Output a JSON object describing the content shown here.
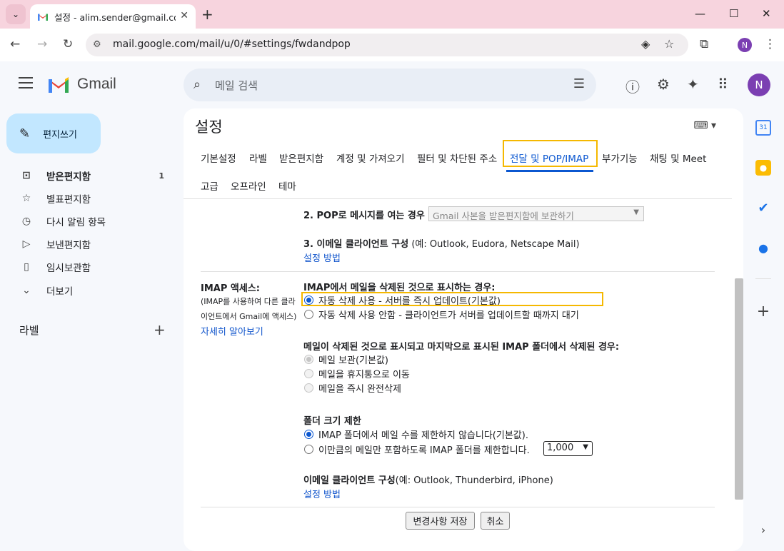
{
  "browser": {
    "tab_title": "설정 - alim.sender@gmail.com",
    "url": "mail.google.com/mail/u/0/#settings/fwdandpop",
    "profile_initial": "N"
  },
  "gmail": {
    "logo_text": "Gmail",
    "search_placeholder": "메일 검색",
    "avatar_initial": "N",
    "compose_label": "편지쓰기",
    "nav": [
      {
        "label": "받은편지함",
        "count": "1",
        "icon": "inbox-icon"
      },
      {
        "label": "별표편지함",
        "count": "",
        "icon": "star-icon"
      },
      {
        "label": "다시 알림 항목",
        "count": "",
        "icon": "clock-icon"
      },
      {
        "label": "보낸편지함",
        "count": "",
        "icon": "send-icon"
      },
      {
        "label": "임시보관함",
        "count": "",
        "icon": "draft-icon"
      },
      {
        "label": "더보기",
        "count": "",
        "icon": "chevron-down-icon"
      }
    ],
    "labels_header": "라벨"
  },
  "settings": {
    "title": "설정",
    "tabs_row1": [
      "기본설정",
      "라벨",
      "받은편지함",
      "계정 및 가져오기",
      "필터 및 차단된 주소",
      "전달 및 POP/IMAP",
      "부가기능",
      "채팅 및 Meet"
    ],
    "tabs_row2": [
      "고급",
      "오프라인",
      "테마"
    ],
    "pop": {
      "item2_label": "2. POP로 메시지를 여는 경우",
      "item2_select": "Gmail 사본을 받은편지함에 보관하기",
      "item3_label": "3. 이메일 클라이언트 구성",
      "item3_example": "(예: Outlook, Eudora, Netscape Mail)",
      "item3_link": "설정 방법"
    },
    "imap": {
      "side_title": "IMAP 액세스:",
      "side_desc1": "(IMAP를 사용하여 다른 클라",
      "side_desc2": "이언트에서 Gmail에 액세스)",
      "side_link": "자세히 알아보기",
      "delete_title": "IMAP에서 메일을 삭제된 것으로 표시하는 경우:",
      "delete_opt1": "자동 삭제 사용 - 서버를 즉시 업데이트(기본값)",
      "delete_opt2": "자동 삭제 사용 안함 - 클라이언트가 서버를 업데이트할 때까지 대기",
      "expunge_title": "메일이 삭제된 것으로 표시되고 마지막으로 표시된 IMAP 폴더에서 삭제된 경우:",
      "expunge_opt1": "메일 보관(기본값)",
      "expunge_opt2": "메일을 휴지통으로 이동",
      "expunge_opt3": "메일을 즉시 완전삭제",
      "folder_title": "폴더 크기 제한",
      "folder_opt1": "IMAP 폴더에서 메일 수를 제한하지 않습니다(기본값).",
      "folder_opt2": "이만큼의 메일만 포함하도록 IMAP 폴더를 제한합니다.",
      "folder_limit": "1,000",
      "client_title": "이메일 클라이언트 구성",
      "client_example": "(예: Outlook, Thunderbird, iPhone)",
      "client_link": "설정 방법"
    },
    "save_button": "변경사항 저장",
    "cancel_button": "취소"
  },
  "colors": {
    "accent": "#0b57d0",
    "highlight": "#f5b800",
    "compose_bg": "#c2e7ff"
  }
}
